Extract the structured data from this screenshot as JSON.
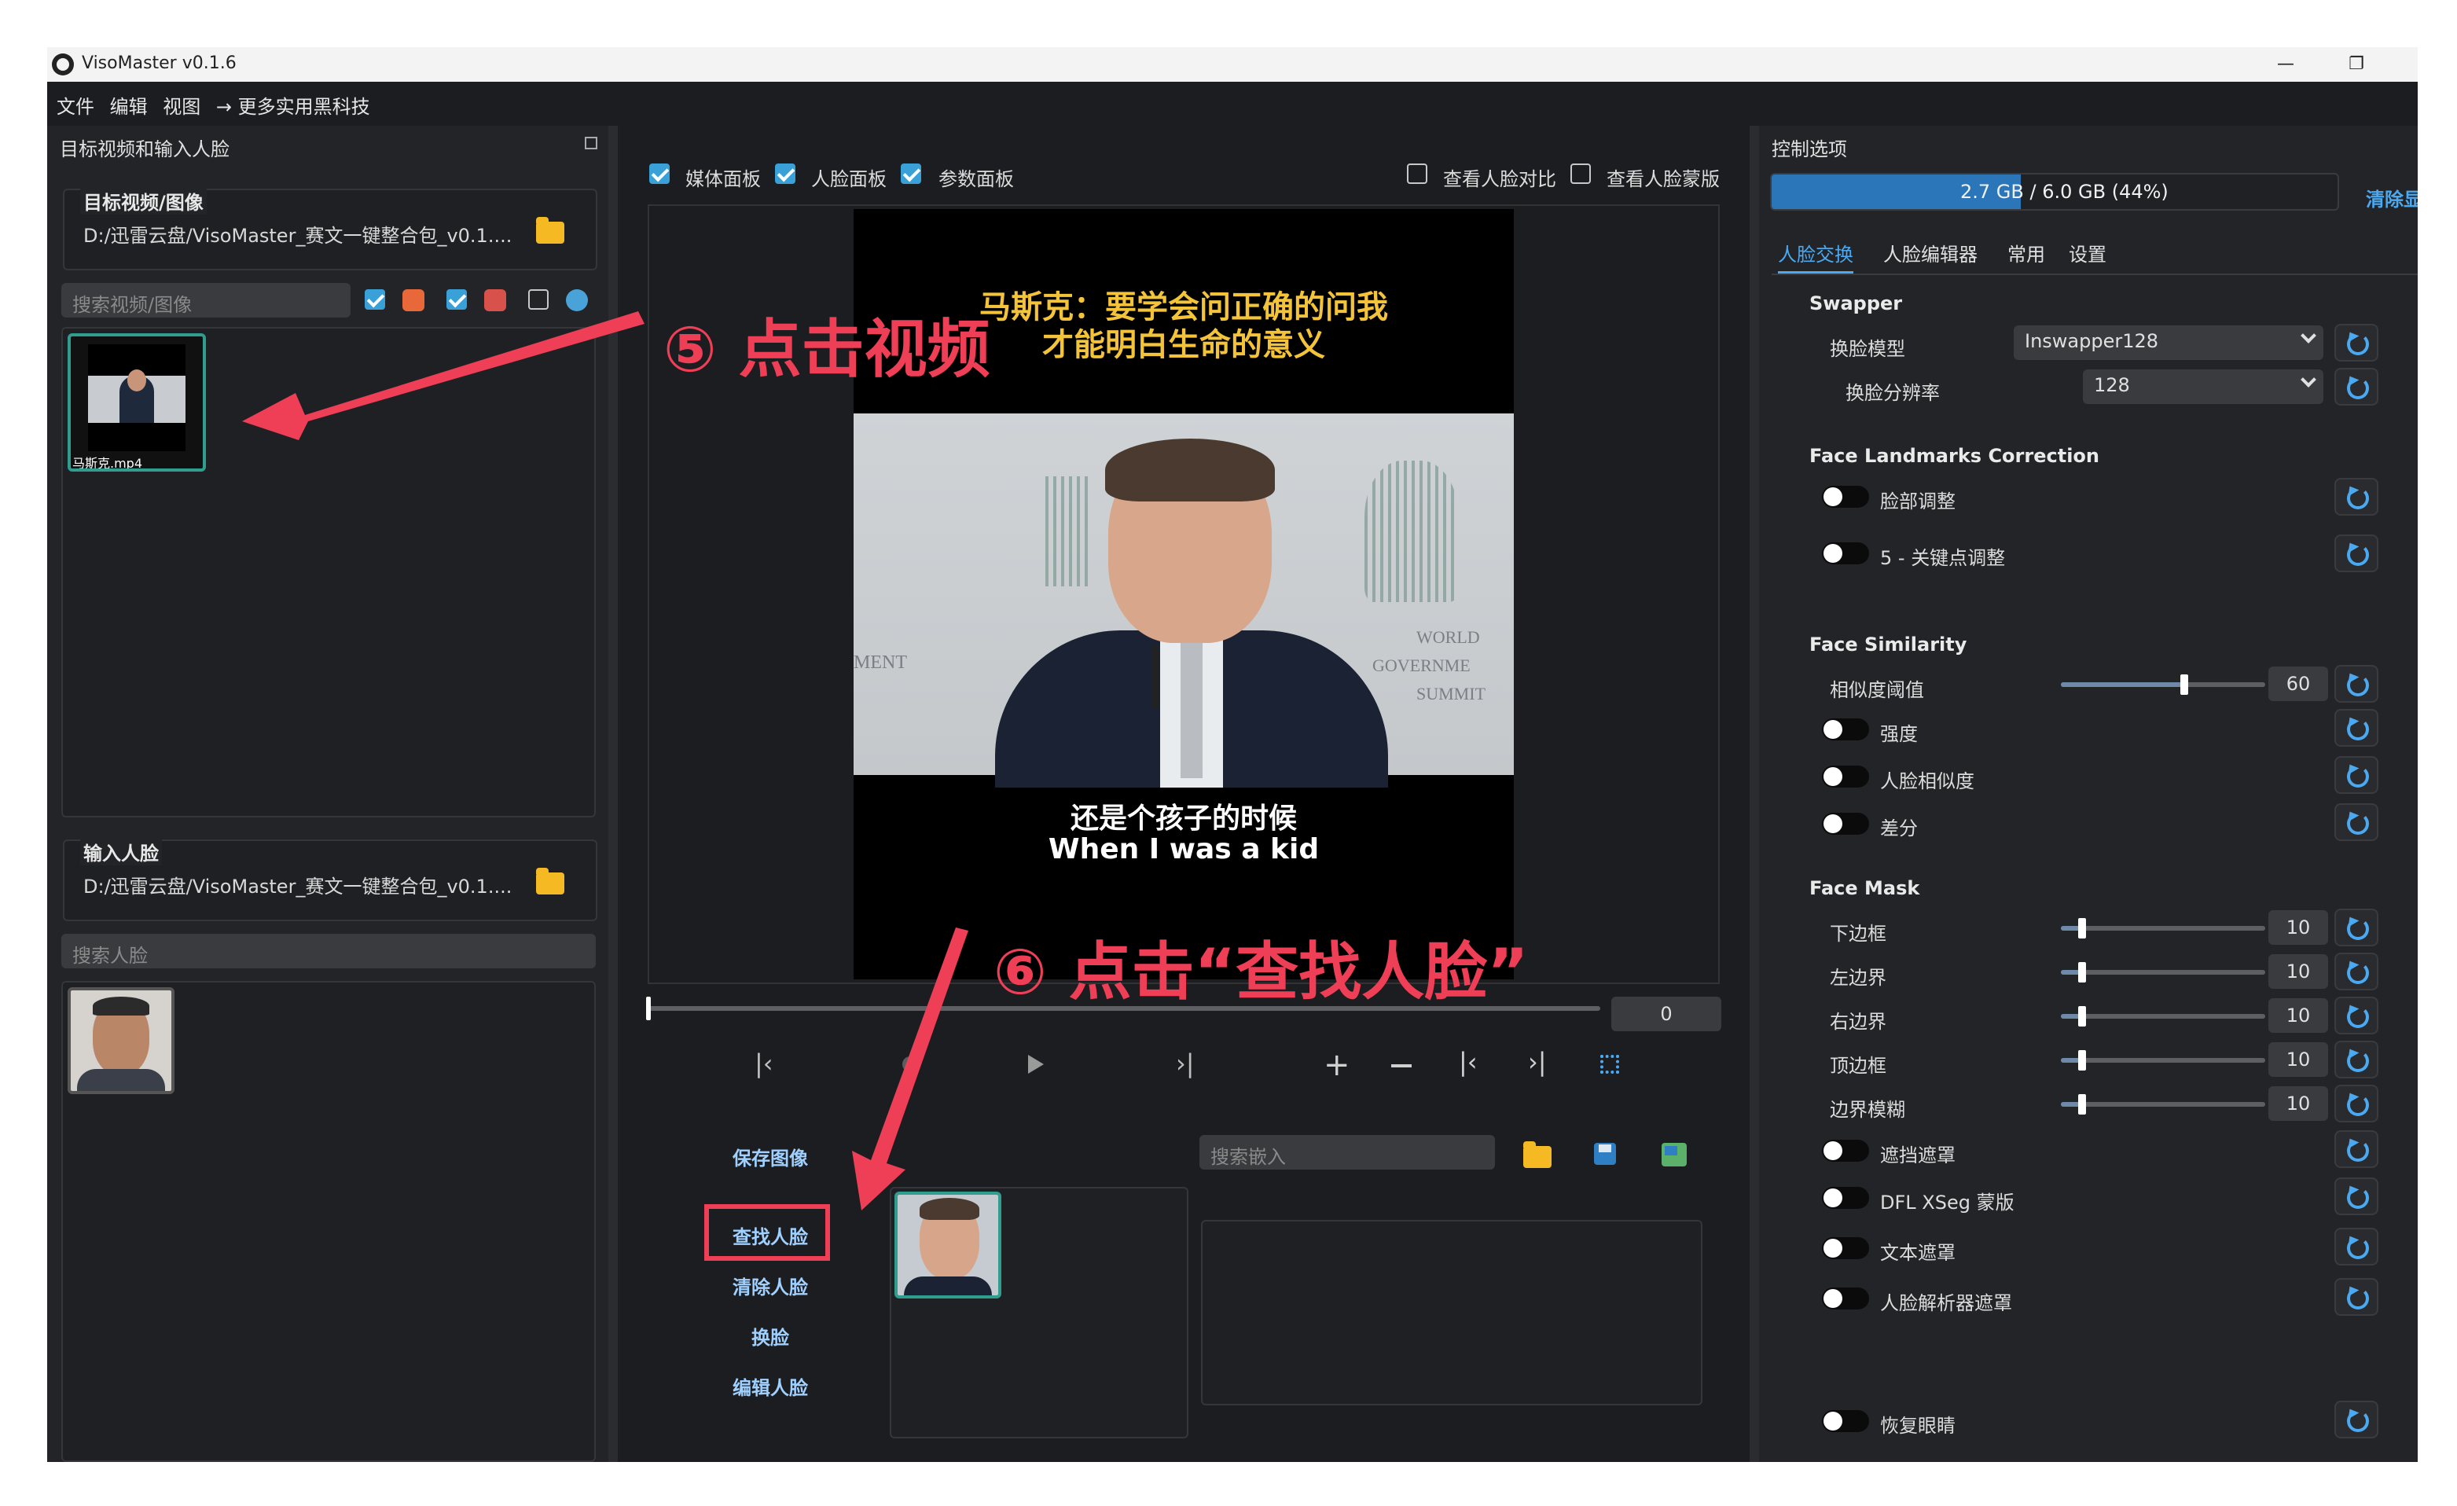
{
  "window": {
    "title": "VisoMaster v0.1.6",
    "min_glyph": "—",
    "restore_glyph": "❐"
  },
  "menu": [
    "文件",
    "编辑",
    "视图",
    "→ 更多实用黑科技"
  ],
  "left_panel": {
    "header": "目标视频和输入人脸",
    "target_label": "目标视频/图像",
    "target_path": "D:/迅雷云盘/VisoMaster_赛文一键整合包_v0.1....",
    "search_media_placeholder": "搜索视频/图像",
    "media_items": [
      {
        "label": "马斯克.mp4"
      }
    ],
    "input_face_label": "输入人脸",
    "input_face_path": "D:/迅雷云盘/VisoMaster_赛文一键整合包_v0.1....",
    "search_face_placeholder": "搜索人脸"
  },
  "center": {
    "checkboxes": [
      {
        "label": "媒体面板",
        "checked": true
      },
      {
        "label": "人脸面板",
        "checked": true
      },
      {
        "label": "参数面板",
        "checked": true
      },
      {
        "label": "查看人脸对比",
        "checked": false
      },
      {
        "label": "查看人脸蒙版",
        "checked": false
      }
    ],
    "video": {
      "caption_top_line1": "马斯克：要学会问正确的问我",
      "caption_top_line2": "才能明白生命的意义",
      "subtitle_cn": "还是个孩子的时候",
      "subtitle_en": "When I was a kid",
      "sign_left": "MENT",
      "sign_right_1": "WORLD",
      "sign_right_2": "GOVERNME",
      "sign_right_3": "SUMMIT"
    },
    "frame_number": "0",
    "timeline_progress": 0,
    "actions": [
      "保存图像",
      "查找人脸",
      "清除人脸",
      "换脸",
      "编辑人脸"
    ],
    "search_embedding_placeholder": "搜索嵌入"
  },
  "annotations": {
    "step5": "⑤ 点击视频",
    "step6": "⑥ 点击“查找人脸”"
  },
  "right_panel": {
    "header": "控制选项",
    "memory_text": "2.7 GB / 6.0 GB (44%)",
    "memory_fraction": 0.44,
    "clear_label": "清除显",
    "tabs": [
      "人脸交换",
      "人脸编辑器",
      "常用",
      "设置"
    ],
    "active_tab": 0,
    "swapper": {
      "title": "Swapper",
      "model_label": "换脸模型",
      "model_value": "Inswapper128",
      "res_label": "换脸分辨率",
      "res_value": "128"
    },
    "landmarks": {
      "title": "Face Landmarks Correction",
      "items": [
        "脸部调整",
        "5 - 关键点调整"
      ]
    },
    "similarity": {
      "title": "Face Similarity",
      "threshold_label": "相似度阈值",
      "threshold_value": "60",
      "threshold_fraction": 0.6,
      "toggles": [
        "强度",
        "人脸相似度",
        "差分"
      ]
    },
    "mask": {
      "title": "Face Mask",
      "sliders": [
        {
          "label": "下边框",
          "value": "10"
        },
        {
          "label": "左边界",
          "value": "10"
        },
        {
          "label": "右边界",
          "value": "10"
        },
        {
          "label": "顶边框",
          "value": "10"
        },
        {
          "label": "边界模糊",
          "value": "10"
        }
      ],
      "slider_fraction": 0.1,
      "toggles": [
        "遮挡遮罩",
        "DFL XSeg 蒙版",
        "文本遮罩",
        "人脸解析器遮罩"
      ]
    },
    "restore_eyes": "恢复眼睛"
  }
}
